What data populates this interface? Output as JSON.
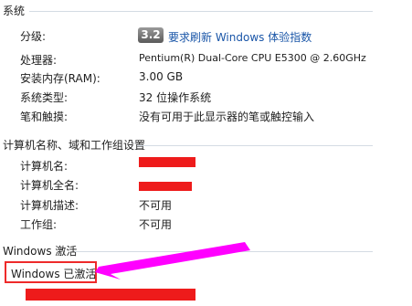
{
  "system_section": {
    "title": "系统",
    "rating_label": "分级:",
    "rating_score": "3.2",
    "rating_link": "要求刷新 Windows 体验指数",
    "processor_label": "处理器:",
    "processor_value": "Pentium(R) Dual-Core  CPU      E5300  @ 2.60GHz",
    "ram_label": "安装内存(RAM):",
    "ram_value": "3.00 GB",
    "type_label": "系统类型:",
    "type_value": "32 位操作系统",
    "pen_label": "笔和触摸:",
    "pen_value": "没有可用于此显示器的笔或触控输入"
  },
  "computer_section": {
    "title": "计算机名称、域和工作组设置",
    "name_label": "计算机名:",
    "fullname_label": "计算机全名:",
    "desc_label": "计算机描述:",
    "desc_value": "不可用",
    "workgroup_label": "工作组:",
    "workgroup_value": "不可用"
  },
  "activation_section": {
    "title": "Windows 激活",
    "status": "Windows 已激活"
  },
  "colors": {
    "annotation_arrow": "#ff00ff",
    "annotation_box": "#ee2a2a",
    "redaction": "#ee1b1b"
  }
}
